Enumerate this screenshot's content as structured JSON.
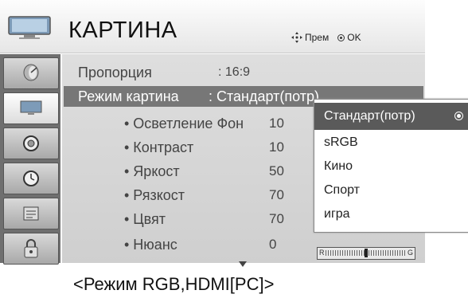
{
  "header": {
    "title": "КАРТИНА",
    "move_hint": "Прем",
    "ok_hint": "OK"
  },
  "sidebar": {
    "items": [
      {
        "icon": "satellite-dish-icon",
        "active": false
      },
      {
        "icon": "tv-screen-icon",
        "active": true
      },
      {
        "icon": "speaker-icon",
        "active": false
      },
      {
        "icon": "clock-icon",
        "active": false
      },
      {
        "icon": "options-panel-icon",
        "active": false
      },
      {
        "icon": "lock-icon",
        "active": false
      }
    ]
  },
  "menu": {
    "aspect": {
      "label": "Пропорция",
      "value": ": 16:9"
    },
    "picture_mode": {
      "label": "Режим картина",
      "value": ": Стандарт(потр)"
    },
    "items": [
      {
        "label": "• Осветление Фон",
        "value": "10"
      },
      {
        "label": "• Контраст",
        "value": "10"
      },
      {
        "label": "• Яркост",
        "value": "50"
      },
      {
        "label": "• Рязкост",
        "value": "70"
      },
      {
        "label": "• Цвят",
        "value": "70"
      },
      {
        "label": "• Нюанс",
        "value": "0"
      }
    ],
    "tint_slider": {
      "left_label": "R",
      "right_label": "G",
      "value_fraction": 0.5
    }
  },
  "dropdown": {
    "options": [
      "Стандарт(потр)",
      "sRGB",
      "Кино",
      "Спорт",
      "игра"
    ],
    "selected_index": 0
  },
  "footer": {
    "mode_label": "<Режим RGB,HDMI[PC]>"
  },
  "colors": {
    "selected_row": "#777777",
    "sidebar": "#6f6f6f",
    "panel": "#d6d6d6"
  }
}
